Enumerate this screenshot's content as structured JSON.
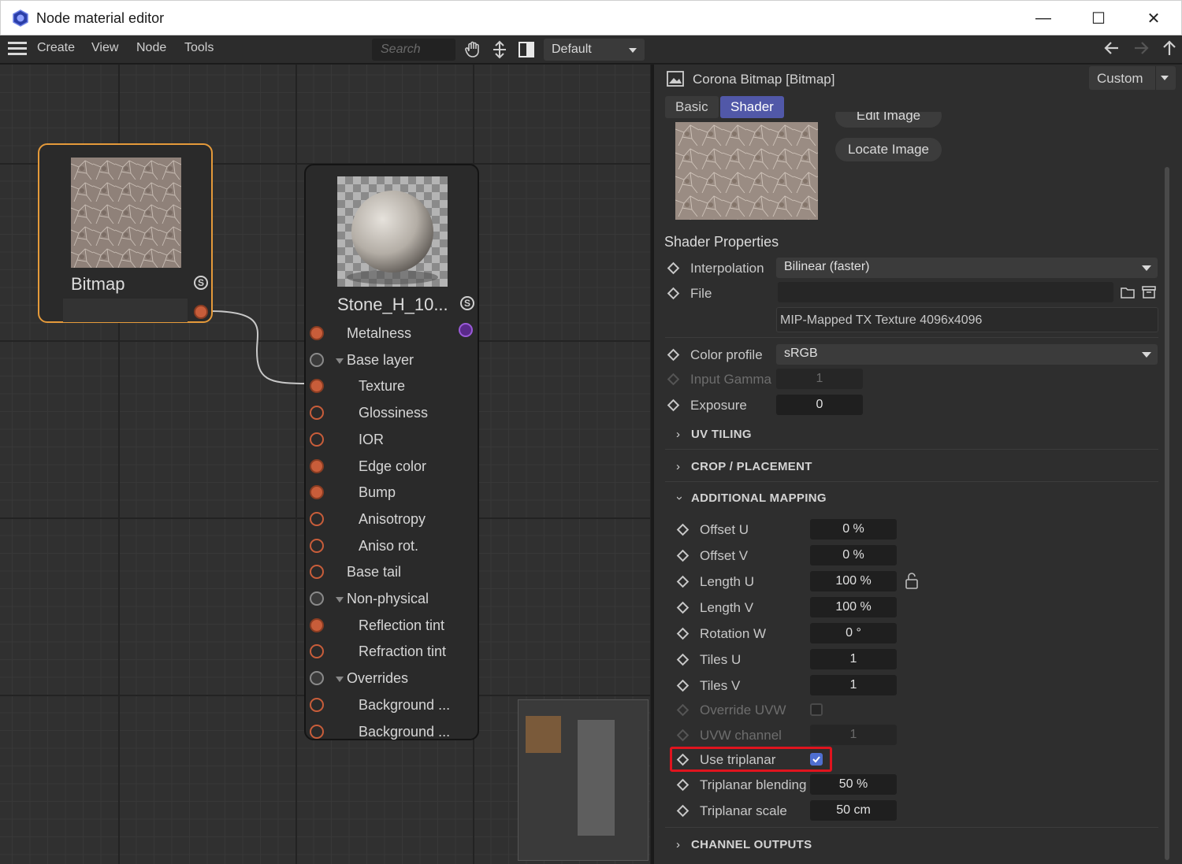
{
  "window": {
    "title": "Node material editor",
    "minimize": "—",
    "maximize": "☐",
    "close": "✕"
  },
  "menu": {
    "items": [
      "Create",
      "View",
      "Node",
      "Tools"
    ],
    "search_placeholder": "Search",
    "layout": "Default"
  },
  "nodes": {
    "bitmap": {
      "title": "Bitmap",
      "s": "S"
    },
    "stone": {
      "title": "Stone_H_10...",
      "s": "S",
      "ports": [
        {
          "label": "Metalness",
          "indent": 0,
          "type": "orange",
          "group": false
        },
        {
          "label": "Base layer",
          "indent": 0,
          "type": "grey",
          "group": true
        },
        {
          "label": "Texture",
          "indent": 1,
          "type": "orange",
          "group": false
        },
        {
          "label": "Glossiness",
          "indent": 1,
          "type": "hollow",
          "group": false
        },
        {
          "label": "IOR",
          "indent": 1,
          "type": "hollow",
          "group": false
        },
        {
          "label": "Edge color",
          "indent": 1,
          "type": "orange",
          "group": false
        },
        {
          "label": "Bump",
          "indent": 1,
          "type": "orange",
          "group": false
        },
        {
          "label": "Anisotropy",
          "indent": 1,
          "type": "hollow",
          "group": false
        },
        {
          "label": "Aniso rot.",
          "indent": 1,
          "type": "hollow",
          "group": false
        },
        {
          "label": "Base tail",
          "indent": 0,
          "type": "hollow",
          "group": false
        },
        {
          "label": "Non-physical",
          "indent": 0,
          "type": "grey",
          "group": true
        },
        {
          "label": "Reflection tint",
          "indent": 1,
          "type": "orange",
          "group": false
        },
        {
          "label": "Refraction tint",
          "indent": 1,
          "type": "hollow",
          "group": false
        },
        {
          "label": "Overrides",
          "indent": 0,
          "type": "grey",
          "group": true
        },
        {
          "label": "Background ...",
          "indent": 1,
          "type": "hollow",
          "group": false
        },
        {
          "label": "Background ...",
          "indent": 1,
          "type": "hollow",
          "group": false
        }
      ]
    }
  },
  "panel": {
    "header": "Corona Bitmap [Bitmap]",
    "preset": "Custom",
    "tabs": [
      "Basic",
      "Shader"
    ],
    "active_tab": "Shader",
    "edit_image": "Edit Image",
    "locate_image": "Locate Image",
    "shader_properties": "Shader Properties",
    "interpolation": {
      "label": "Interpolation",
      "value": "Bilinear (faster)"
    },
    "file": {
      "label": "File",
      "value": ""
    },
    "file_info": "MIP-Mapped TX Texture 4096x4096",
    "color_profile": {
      "label": "Color profile",
      "value": "sRGB"
    },
    "input_gamma": {
      "label": "Input Gamma",
      "value": "1"
    },
    "exposure": {
      "label": "Exposure",
      "value": "0"
    },
    "sections": {
      "uv_tiling": "UV TILING",
      "crop": "CROP / PLACEMENT",
      "additional": "ADDITIONAL MAPPING",
      "channel": "CHANNEL OUTPUTS"
    },
    "mapping": {
      "offset_u": {
        "label": "Offset U",
        "value": "0 %"
      },
      "offset_v": {
        "label": "Offset V",
        "value": "0 %"
      },
      "length_u": {
        "label": "Length U",
        "value": "100 %"
      },
      "length_v": {
        "label": "Length V",
        "value": "100 %"
      },
      "rotation_w": {
        "label": "Rotation W",
        "value": "0 °"
      },
      "tiles_u": {
        "label": "Tiles U",
        "value": "1"
      },
      "tiles_v": {
        "label": "Tiles V",
        "value": "1"
      },
      "override_uvw": {
        "label": "Override UVW",
        "checked": false
      },
      "uvw_channel": {
        "label": "UVW channel",
        "value": "1"
      },
      "use_triplanar": {
        "label": "Use triplanar",
        "checked": true
      },
      "triplanar_blending": {
        "label": "Triplanar blending",
        "value": "50 %"
      },
      "triplanar_scale": {
        "label": "Triplanar scale",
        "value": "50 cm"
      }
    }
  },
  "colors": {
    "selected_node_border": "#e59a3a",
    "active_tab": "#5158a8",
    "highlight_box": "#e0141e",
    "port_orange": "#c85d3a",
    "port_purple": "#7a3ab8"
  }
}
